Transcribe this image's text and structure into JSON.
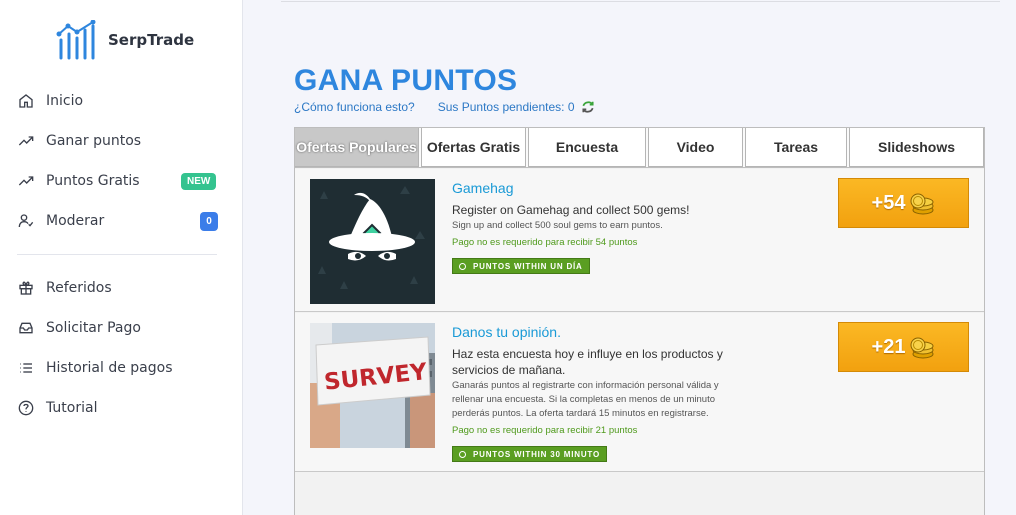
{
  "brand": {
    "name": "SerpTrade"
  },
  "sidebar": {
    "items": [
      {
        "label": "Inicio",
        "icon": "home-icon"
      },
      {
        "label": "Ganar puntos",
        "icon": "trending-up-icon"
      },
      {
        "label": "Puntos Gratis",
        "icon": "trending-up-icon",
        "badge": "NEW"
      },
      {
        "label": "Moderar",
        "icon": "user-check-icon",
        "count": "0"
      }
    ],
    "items2": [
      {
        "label": "Referidos",
        "icon": "gift-icon"
      },
      {
        "label": "Solicitar Pago",
        "icon": "inbox-icon"
      },
      {
        "label": "Historial de pagos",
        "icon": "list-icon"
      },
      {
        "label": "Tutorial",
        "icon": "help-circle-icon"
      }
    ]
  },
  "main": {
    "title": "GANA PUNTOS",
    "how_link": "¿Cómo funciona esto?",
    "pending": "Sus Puntos pendientes: 0",
    "tabs": [
      "Ofertas Populares",
      "Ofertas Gratis",
      "Encuesta",
      "Video",
      "Tareas",
      "Slideshows"
    ],
    "offers": [
      {
        "title": "Gamehag",
        "desc": "Register on Gamehag and collect 500 gems!",
        "small": "Sign up and collect 500 soul gems to earn puntos.",
        "note": "Pago no es requerido para recibir 54 puntos",
        "tag": "PUNTOS WITHIN UN DÍA",
        "points": "+54"
      },
      {
        "title": "Danos tu opinión.",
        "desc": "Haz esta encuesta hoy e influye en los productos y servicios de mañana.",
        "small": "Ganarás puntos al registrarte con información personal válida y rellenar una encuesta. Si la completas en menos de un minuto perderás puntos. La oferta tardará 15 minutos en registrarse.",
        "note": "Pago no es requerido para recibir 21 puntos",
        "tag": "PUNTOS WITHIN 30 MINUTO",
        "points": "+21",
        "image_text": "SURVEY"
      }
    ]
  },
  "colors": {
    "accent": "#2e86de",
    "button": "#f5a614",
    "tag": "#5a9e21",
    "new_badge": "#34c38f",
    "count_badge": "#3b7de9"
  }
}
